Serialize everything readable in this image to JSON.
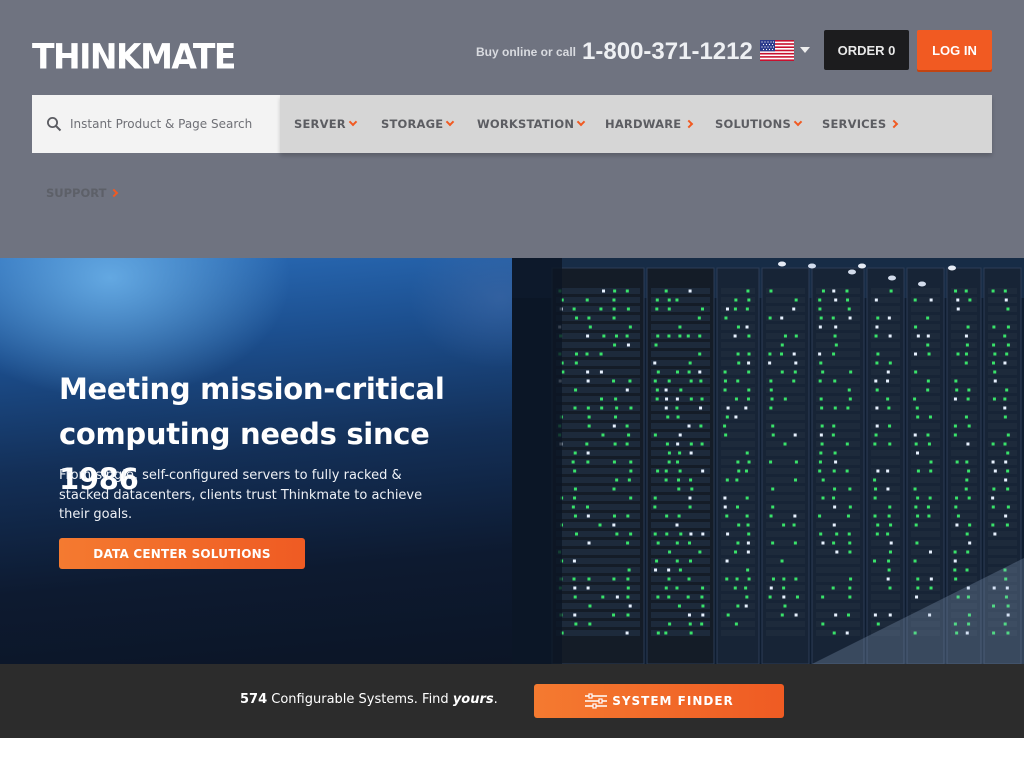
{
  "header": {
    "logo_text": "THINKMATE",
    "buy_text": "Buy online or call",
    "phone": "1-800-371-1212",
    "flag_icon": "us-flag-icon",
    "order_label": "ORDER 0",
    "login_label": "LOG IN"
  },
  "search": {
    "placeholder": "Instant Product & Page Search",
    "icon": "search-icon"
  },
  "nav": {
    "items": [
      {
        "label": "SERVER",
        "chevron": "down"
      },
      {
        "label": "STORAGE",
        "chevron": "down"
      },
      {
        "label": "WORKSTATION",
        "chevron": "down"
      },
      {
        "label": "HARDWARE",
        "chevron": "right"
      },
      {
        "label": "SOLUTIONS",
        "chevron": "down"
      },
      {
        "label": "SERVICES",
        "chevron": "right"
      },
      {
        "label": "SUPPORT",
        "chevron": "right"
      }
    ]
  },
  "hero": {
    "title": "Meeting mission-critical computing needs since 1986",
    "subtitle": "From single, self-configured servers to fully racked & stacked datacenters, clients trust Thinkmate to achieve their goals.",
    "cta_label": "DATA CENTER SOLUTIONS"
  },
  "finder": {
    "count": "574",
    "text_mid": " Configurable Systems. Find ",
    "text_em": "yours",
    "text_end": ".",
    "button_label": "SYSTEM FINDER",
    "button_icon": "sliders-icon"
  },
  "colors": {
    "accent": "#f15a22",
    "header_bg": "#6f7380",
    "nav_bg": "#d6d6d6",
    "finder_bg": "#2c2c2c"
  }
}
